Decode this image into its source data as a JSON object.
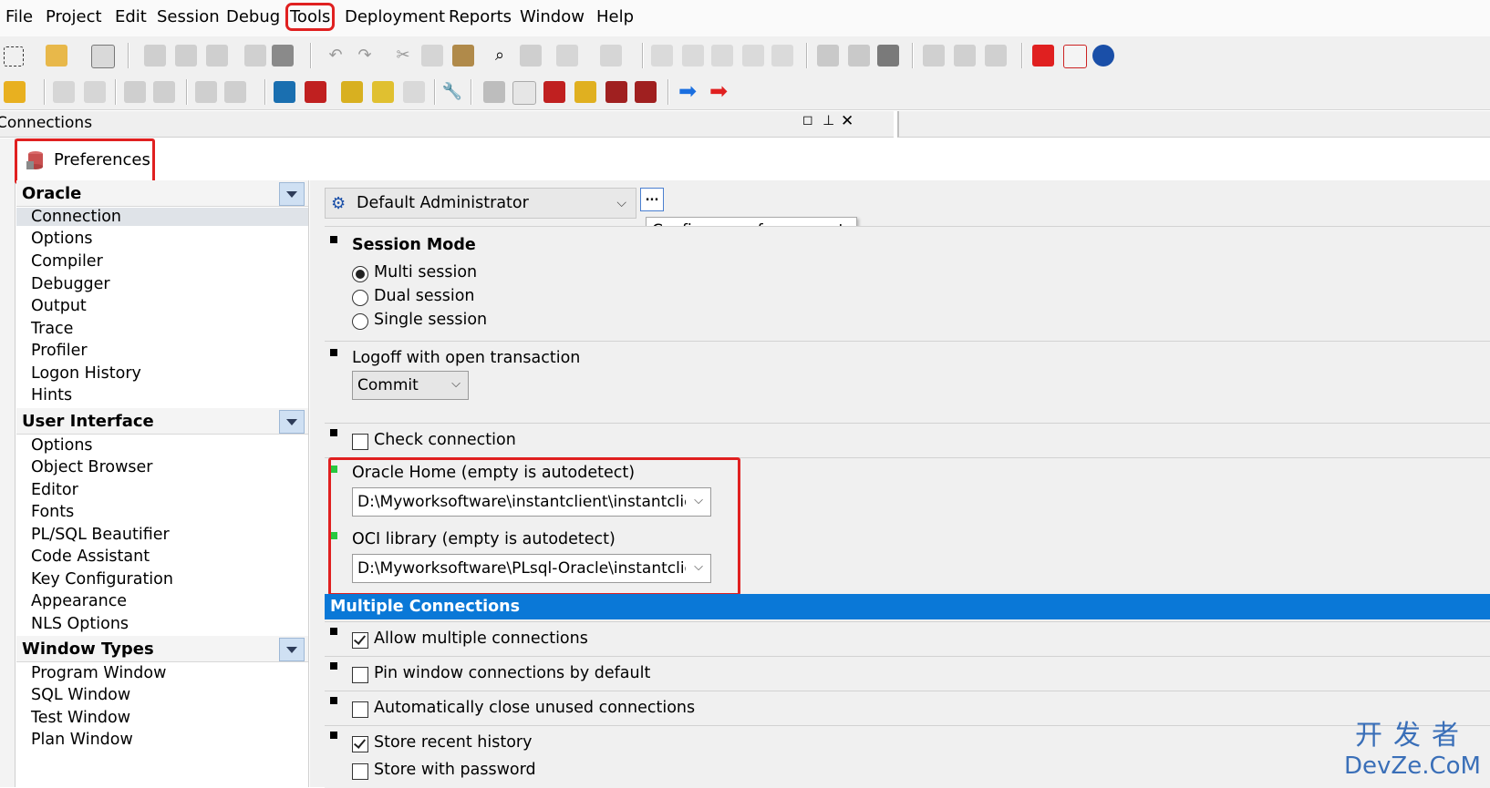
{
  "menubar": {
    "items": [
      "File",
      "Project",
      "Edit",
      "Session",
      "Debug",
      "Tools",
      "Deployment",
      "Reports",
      "Window",
      "Help"
    ],
    "highlighted": "Tools"
  },
  "connections_bar": {
    "title": "Connections"
  },
  "preferences": {
    "title": "Preferences",
    "groups": [
      {
        "name": "Oracle",
        "items": [
          "Connection",
          "Options",
          "Compiler",
          "Debugger",
          "Output",
          "Trace",
          "Profiler",
          "Logon History",
          "Hints"
        ],
        "selected": "Connection"
      },
      {
        "name": "User Interface",
        "items": [
          "Options",
          "Object Browser",
          "Editor",
          "Fonts",
          "PL/SQL Beautifier",
          "Code Assistant",
          "Key Configuration",
          "Appearance",
          "NLS Options"
        ]
      },
      {
        "name": "Window Types",
        "items": [
          "Program Window",
          "SQL Window",
          "Test Window",
          "Plan Window"
        ]
      }
    ],
    "preference_set": "Default Administrator",
    "configure_button": "...",
    "tooltip": "Configure preference sets",
    "session_mode": {
      "label": "Session Mode",
      "options": [
        "Multi session",
        "Dual session",
        "Single session"
      ],
      "selected": "Multi session"
    },
    "logoff": {
      "label": "Logoff with open transaction",
      "value": "Commit"
    },
    "check_connection": {
      "label": "Check connection",
      "checked": false
    },
    "oracle_home": {
      "label": "Oracle Home (empty is autodetect)",
      "value": "D:\\Myworksoftware\\instantclient\\instantclient"
    },
    "oci_library": {
      "label": "OCI library (empty is autodetect)",
      "value": "D:\\Myworksoftware\\PLsql-Oracle\\instantclient"
    },
    "multiple_connections": {
      "header": "Multiple Connections",
      "options": [
        {
          "label": "Allow multiple connections",
          "checked": true
        },
        {
          "label": "Pin window connections by default",
          "checked": false
        },
        {
          "label": "Automatically close unused connections",
          "checked": false
        },
        {
          "label": "Store recent history",
          "checked": true
        },
        {
          "label": "Store with password",
          "checked": false
        }
      ]
    }
  },
  "watermark": {
    "cn": "开发者",
    "en": "DevZe.CoM"
  },
  "colors": {
    "accent": "#0a78d7",
    "highlight": "#e02020",
    "modified": "#27c93f"
  }
}
